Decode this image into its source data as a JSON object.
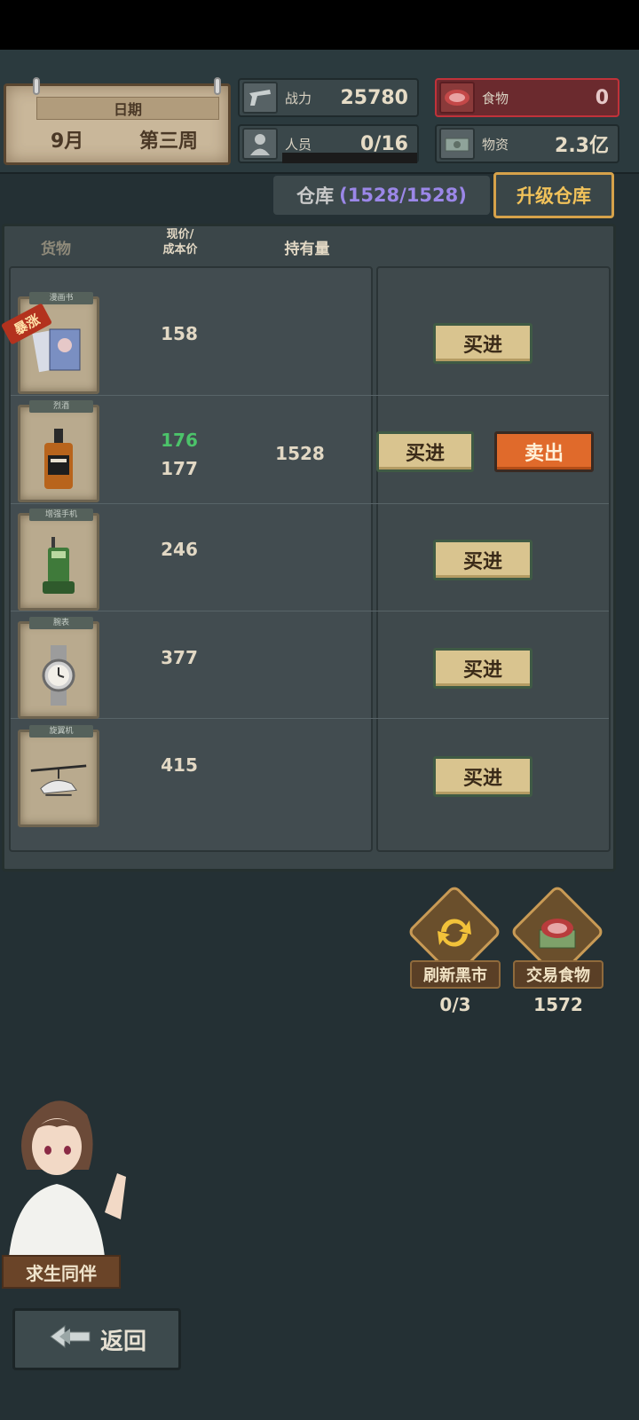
{
  "date": {
    "label": "日期",
    "month": "9月",
    "week": "第三周"
  },
  "stats": {
    "combat": {
      "label": "战力",
      "value": "25780",
      "icon": "pistol-icon"
    },
    "people": {
      "label": "人员",
      "value": "0/16",
      "icon": "person-icon"
    },
    "food": {
      "label": "食物",
      "value": "0",
      "icon": "meat-icon"
    },
    "supplies": {
      "label": "物资",
      "value": "2.3亿",
      "icon": "money-icon"
    }
  },
  "warehouse": {
    "label": "仓库",
    "capacity": "(1528/1528)",
    "upgrade_label": "升级仓库"
  },
  "table": {
    "headers": {
      "goods": "货物",
      "price_line1": "现价/",
      "price_line2": "成本价",
      "holding": "持有量"
    },
    "hot_badge": "暴涨",
    "rows": [
      {
        "name": "漫画书",
        "price": "158",
        "cost": "",
        "holding": "",
        "buy": "买进",
        "sell": ""
      },
      {
        "name": "烈酒",
        "price": "176",
        "cost": "177",
        "holding": "1528",
        "buy": "买进",
        "sell": "卖出"
      },
      {
        "name": "增强手机",
        "price": "246",
        "cost": "",
        "holding": "",
        "buy": "买进",
        "sell": ""
      },
      {
        "name": "腕表",
        "price": "377",
        "cost": "",
        "holding": "",
        "buy": "买进",
        "sell": ""
      },
      {
        "name": "旋翼机",
        "price": "415",
        "cost": "",
        "holding": "",
        "buy": "买进",
        "sell": ""
      }
    ]
  },
  "actions": {
    "refresh": {
      "label": "刷新黑市",
      "count": "0/3"
    },
    "trade_food": {
      "label": "交易食物",
      "count": "1572"
    }
  },
  "companion": {
    "label": "求生同伴"
  },
  "back": {
    "label": "返回"
  },
  "colors": {
    "accent_gold": "#f1c25a",
    "price_up": "#4cc36a",
    "sell": "#e06a2b",
    "capacity": "#9b87e8"
  }
}
